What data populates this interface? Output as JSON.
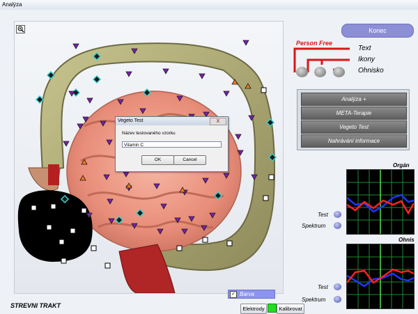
{
  "window": {
    "title": "Analýza"
  },
  "viewer": {
    "zoom_icon": "magnifier-icon"
  },
  "barva": {
    "label": "Barva",
    "checked": true
  },
  "section_title": "STREVNI TRAKT",
  "bottom_buttons": {
    "elektrody": "Elektrody",
    "kalibrovat": "Kalibrovat"
  },
  "konec_label": "Konec",
  "legend": {
    "person_free": "Person Free",
    "text": "Text",
    "ikony": "Ikony",
    "ohnisko": "Ohnisko"
  },
  "menu": [
    {
      "label": "Analýza +"
    },
    {
      "label": "META-Terapie"
    },
    {
      "label": "Vegeto Test"
    },
    {
      "label": "Nahrávání informace"
    }
  ],
  "graphs": {
    "organ_label": "Orgán",
    "ohnis_label": "Ohnis",
    "test_label": "Test",
    "spektrum_label": "Spektrum"
  },
  "dialog": {
    "title": "Vegeto Test",
    "close": "X",
    "field_label": "Název testovaného vzorku",
    "field_value": "Vitamin C",
    "ok": "OK",
    "cancel": "Cancel"
  },
  "colors": {
    "accent_button": "#8d8fd6",
    "legend_red": "#d61818",
    "graph_grid": "#1f8a2e",
    "series_blue": "#1f35ff",
    "series_red": "#ff2222"
  }
}
